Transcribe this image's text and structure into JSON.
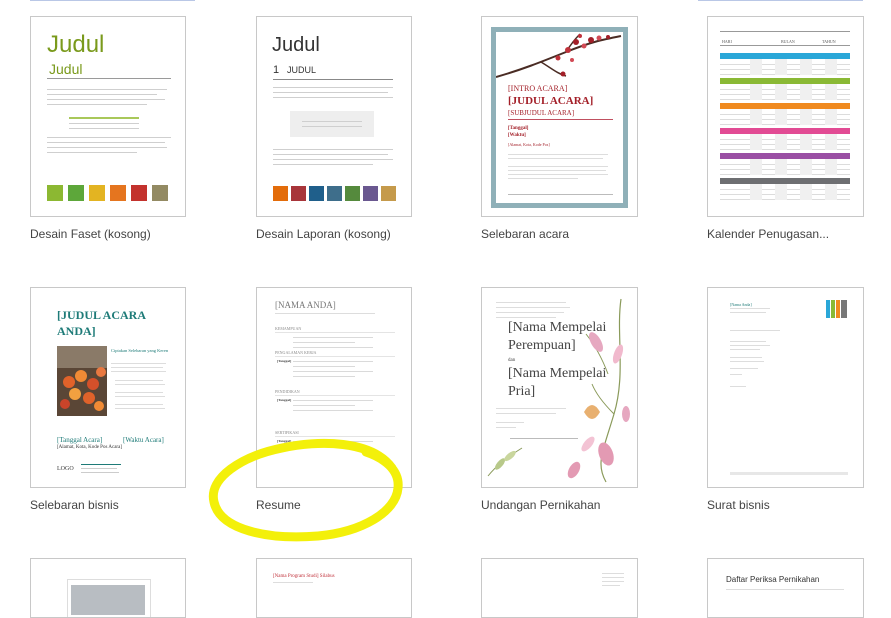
{
  "templates": [
    {
      "caption": "Desain Faset (kosong)",
      "title": "Judul",
      "subtitle": "Judul",
      "title_color": "#7a9a1c",
      "swatches": [
        "#8cb832",
        "#5da73a",
        "#e3b422",
        "#e5751f",
        "#c3322d",
        "#938a63"
      ]
    },
    {
      "caption": "Desain Laporan (kosong)",
      "title": "Judul",
      "heading_num": "1",
      "heading": "JUDUL",
      "swatches": [
        "#e36c0a",
        "#a8353a",
        "#1f5f8b",
        "#3e6e8b",
        "#558a3d",
        "#6a5890",
        "#c59a4b"
      ]
    },
    {
      "caption": "Selebaran acara",
      "intro": "[INTRO ACARA]",
      "title": "[JUDUL ACARA]",
      "subtitle": "[SUBJUDUL ACARA]",
      "date": "[Tanggal]",
      "time": "[Waktu]",
      "address": "[Alamat, Kota, Kode Pos]",
      "border_color": "#8fb0b8",
      "accent": "#a31f28"
    },
    {
      "caption": "Kalender Penugasan...",
      "header": [
        "HARI",
        "BULAN",
        "TAHUN"
      ],
      "band_colors": [
        "#2aa7d8",
        "#8ab935",
        "#f08a1f",
        "#e24b94",
        "#9a4fa4",
        "#6d6e71"
      ]
    },
    {
      "caption": "Selebaran bisnis",
      "title_line1": "[JUDUL ACARA",
      "title_line2": "ANDA]",
      "subtitle": "Ciptakan Selebaran yang Keren",
      "date": "[Tanggal Acara]",
      "time": "[Waktu Acara]",
      "address": "[Alamat, Kota, Kode Pos Acara]",
      "logo": "LOGO",
      "accent": "#1e7b78"
    },
    {
      "caption": "Resume",
      "name": "[NAMA ANDA]",
      "sections": [
        "KEMAMPUAN",
        "PENGALAMAN KERJA",
        "PENDIDIKAN",
        "SERTIFIKASI"
      ],
      "row_labels": [
        "[Tanggal]",
        "[Tanggal]",
        "[Tanggal]",
        "[Tanggal]"
      ]
    },
    {
      "caption": "Undangan Pernikahan",
      "line1": "[Nama Mempelai",
      "line2": "Perempuan]",
      "amp": "dan",
      "line3": "[Nama Mempelai",
      "line4": "Pria]"
    },
    {
      "caption": "Surat bisnis",
      "from": "[Nama Anda]"
    },
    {
      "caption": "",
      "line": "[Nama Program Studi] Silabus"
    },
    {
      "caption": "",
      "line": "Daftar Periksa Pernikahan"
    }
  ],
  "highlight_color": "#f3f00a"
}
